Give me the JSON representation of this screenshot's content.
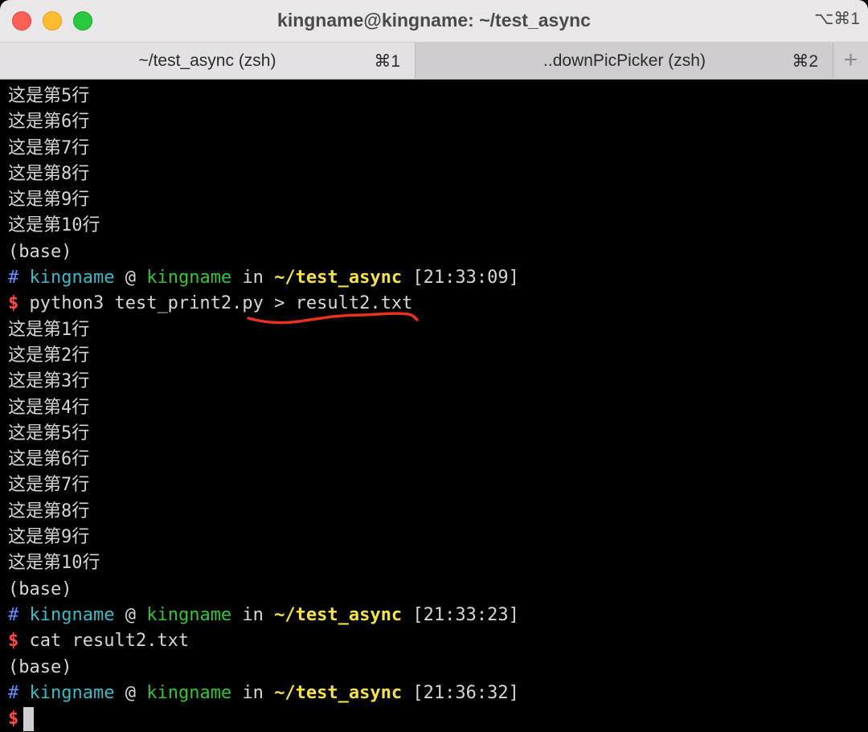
{
  "window": {
    "title": "kingname@kingname: ~/test_async",
    "shortcut": "⌥⌘1"
  },
  "tabs": [
    {
      "label": "~/test_async (zsh)",
      "key": "⌘1",
      "active": true
    },
    {
      "label": "..downPicPicker (zsh)",
      "key": "⌘2",
      "active": false
    }
  ],
  "tab_add_icon": "plus-icon",
  "terminal": {
    "output_block_1": [
      "这是第5行",
      "这是第6行",
      "这是第7行",
      "这是第8行",
      "这是第9行",
      "这是第10行"
    ],
    "base_label": "(base)",
    "prompt_1": {
      "hash": "#",
      "user": "kingname",
      "at": "@",
      "host": "kingname",
      "in": "in",
      "path": "~/test_async",
      "time": "[21:33:09]"
    },
    "command_1": {
      "dollar": "$",
      "text": "python3 test_print2.py > result2.txt"
    },
    "output_block_2": [
      "这是第1行",
      "这是第2行",
      "这是第3行",
      "这是第4行",
      "这是第5行",
      "这是第6行",
      "这是第7行",
      "这是第8行",
      "这是第9行",
      "这是第10行"
    ],
    "prompt_2": {
      "hash": "#",
      "user": "kingname",
      "at": "@",
      "host": "kingname",
      "in": "in",
      "path": "~/test_async",
      "time": "[21:33:23]"
    },
    "command_2": {
      "dollar": "$",
      "text": "cat result2.txt"
    },
    "prompt_3": {
      "hash": "#",
      "user": "kingname",
      "at": "@",
      "host": "kingname",
      "in": "in",
      "path": "~/test_async",
      "time": "[21:36:32]"
    },
    "command_3": {
      "dollar": "$",
      "text": ""
    }
  },
  "colors": {
    "hash": "#6a8dff",
    "user": "#3fb9c6",
    "host": "#38c23a",
    "path": "#f4e24c",
    "dollar": "#ff4d4d",
    "annotation": "#e8321e"
  }
}
